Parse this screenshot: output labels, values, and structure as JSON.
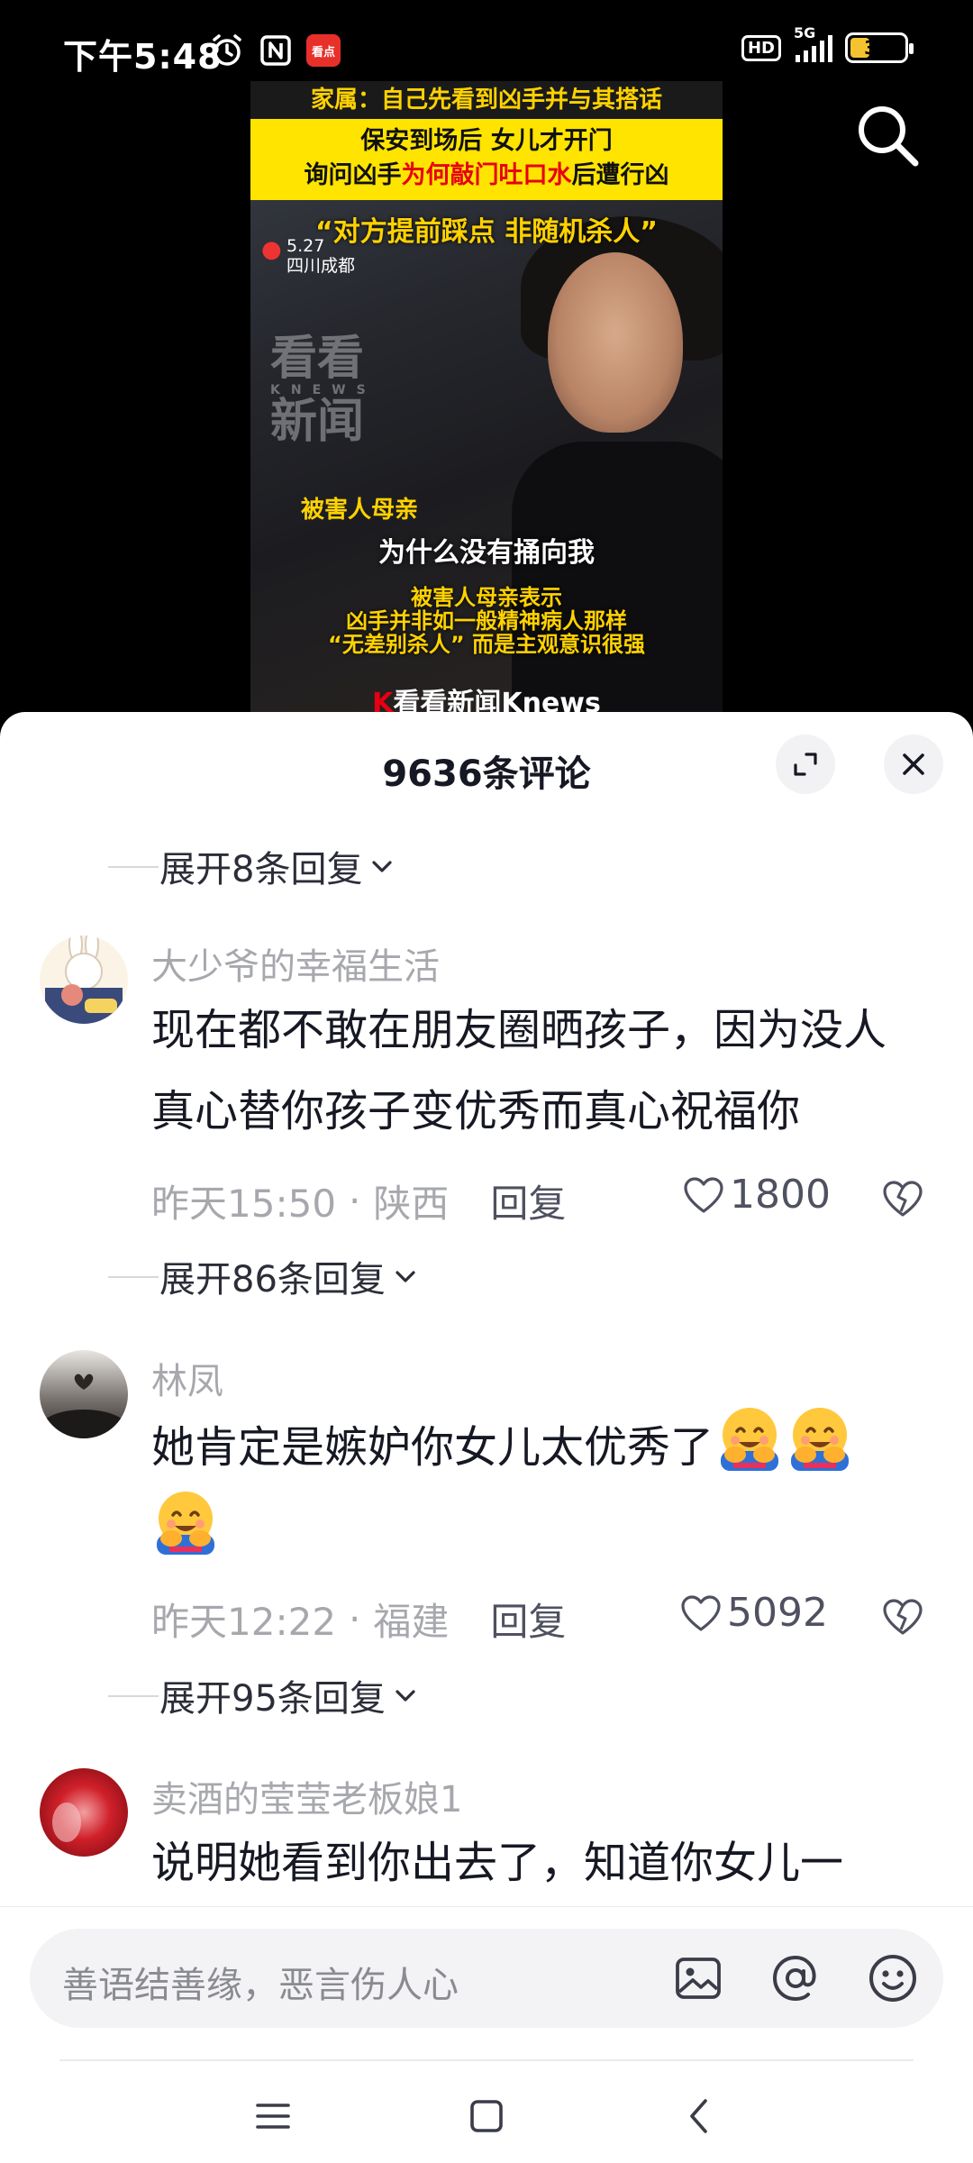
{
  "status_bar": {
    "time": "下午5:48",
    "news_app_badge": "看点",
    "hd": "HD",
    "network": "5G",
    "battery": "36",
    "battery_level": 0.36,
    "icons": [
      "alarm-icon",
      "nfc-icon",
      "news-app-icon",
      "signal-icon",
      "battery-icon"
    ]
  },
  "video": {
    "top_caption": "家属：自己先看到凶手并与其搭话",
    "yellow_line1": "保安到场后  女儿才开门",
    "yellow_line2_a": "询问凶手",
    "yellow_line2_b": "为何敲门吐口水",
    "yellow_line2_c": "后遭行凶",
    "quote": "“对方提前踩点  非随机杀人”",
    "date": "5.27",
    "location": "四川成都",
    "watermark_line1": "看看",
    "watermark_small": "KNEWS",
    "watermark_line2": "新闻",
    "speaker_label": "被害人母亲",
    "subtitle": "为什么没有捅向我",
    "sub_yellow_1": "被害人母亲表示",
    "sub_yellow_2": "凶手并非如一般精神病人那样",
    "sub_yellow_3": "“无差别杀人”  而是主观意识很强",
    "logo_k": "K",
    "logo_text": "看看新闻Knews"
  },
  "sheet": {
    "title": "9636条评论"
  },
  "reply_toggles": [
    "展开8条回复",
    "展开86条回复",
    "展开95条回复"
  ],
  "comments": [
    {
      "username": "大少爷的幸福生活",
      "text": "现在都不敢在朋友圈晒孩子，因为没人真心替你孩子变优秀而真心祝福你",
      "time": "昨天15:50",
      "region": "陕西",
      "reply_label": "回复",
      "likes": "1800"
    },
    {
      "username": "林凤",
      "text": "她肯定是嫉妒你女儿太优秀了",
      "emoji": "hugging-face-emoji",
      "time": "昨天12:22",
      "region": "福建",
      "reply_label": "回复",
      "likes": "5092"
    },
    {
      "username": "卖酒的莹莹老板娘1",
      "text": "说明她看到你出去了，知道你女儿一"
    }
  ],
  "input": {
    "placeholder": "善语结善缘，恶言伤人心"
  },
  "colors": {
    "accent_yellow": "#ffe400",
    "accent_red": "#e60012",
    "muted_text": "#a7a8ad",
    "primary_text": "#161823"
  }
}
